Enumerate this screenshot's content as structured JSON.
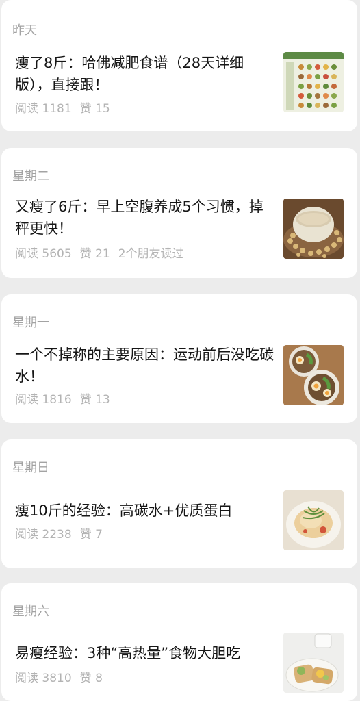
{
  "articles": [
    {
      "day": "昨天",
      "title": "瘦了8斤：哈佛减肥食谱（28天详细版），直接跟！",
      "reads": "阅读 1181",
      "likes": "赞 15",
      "friends": "",
      "thumb_icon": "meal-plan-chart-thumbnail"
    },
    {
      "day": "星期二",
      "title": "又瘦了6斤：早上空腹养成5个习惯，掉秤更快！",
      "reads": "阅读 5605",
      "likes": "赞 21",
      "friends": "2个朋友读过",
      "thumb_icon": "soy-milk-thumbnail"
    },
    {
      "day": "星期一",
      "title": "一个不掉称的主要原因：运动前后没吃碳水！",
      "reads": "阅读 1816",
      "likes": "赞 13",
      "friends": "",
      "thumb_icon": "noodle-bowl-thumbnail"
    },
    {
      "day": "星期日",
      "title": "瘦10斤的经验：高碳水+优质蛋白",
      "reads": "阅读 2238",
      "likes": "赞 7",
      "friends": "",
      "thumb_icon": "dish-thumbnail"
    },
    {
      "day": "星期六",
      "title": "易瘦经验：3种“高热量”食物大胆吃",
      "reads": "阅读 3810",
      "likes": "赞 8",
      "friends": "",
      "thumb_icon": "toast-plate-thumbnail"
    }
  ]
}
